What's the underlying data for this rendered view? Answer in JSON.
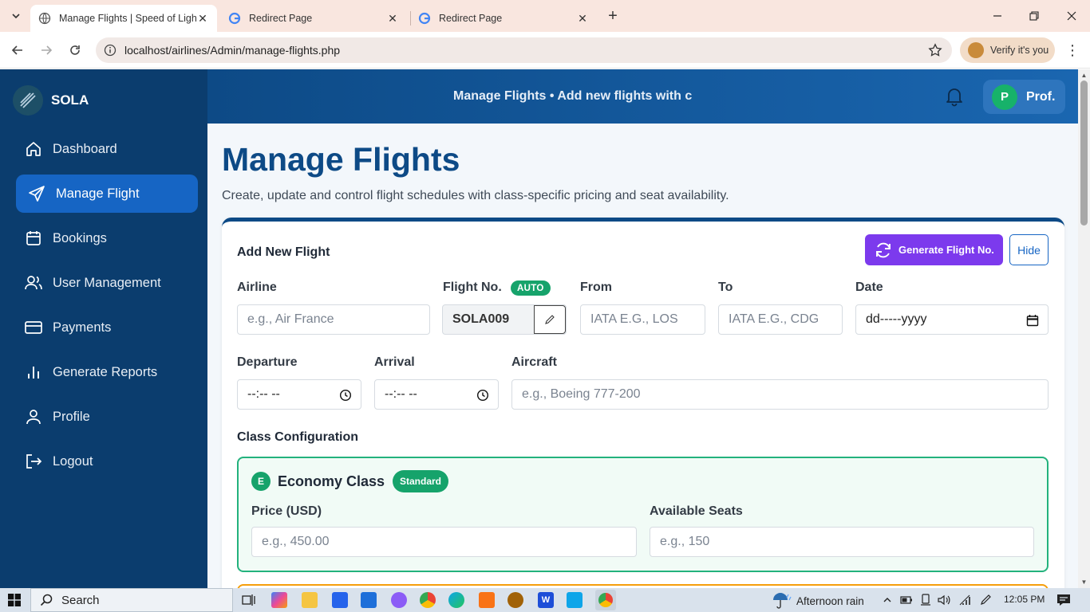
{
  "browser": {
    "tabs": [
      {
        "title": "Manage Flights | Speed of Light",
        "active": true
      },
      {
        "title": "Redirect Page",
        "active": false
      },
      {
        "title": "Redirect Page",
        "active": false
      }
    ],
    "url": "localhost/airlines/Admin/manage-flights.php",
    "verify_label": "Verify it's you"
  },
  "sidebar": {
    "brand": "SOLA",
    "items": [
      {
        "label": "Dashboard",
        "icon": "home-icon"
      },
      {
        "label": "Manage Flight",
        "icon": "plane-icon",
        "active": true
      },
      {
        "label": "Bookings",
        "icon": "calendar-icon"
      },
      {
        "label": "User Management",
        "icon": "users-icon"
      },
      {
        "label": "Payments",
        "icon": "card-icon"
      },
      {
        "label": "Generate Reports",
        "icon": "bar-chart-icon"
      },
      {
        "label": "Profile",
        "icon": "user-icon"
      },
      {
        "label": "Logout",
        "icon": "logout-icon"
      }
    ]
  },
  "header": {
    "title": "Manage Flights • Add new flights with c",
    "avatar_initial": "P",
    "user_name": "Prof."
  },
  "main": {
    "title": "Manage Flights",
    "subtitle": "Create, update and control flight schedules with class-specific pricing and seat availability."
  },
  "form": {
    "card_title": "Add New Flight",
    "generate_label": "Generate Flight No.",
    "hide_label": "Hide",
    "airline": {
      "label": "Airline",
      "placeholder": "e.g., Air France"
    },
    "flight_no": {
      "label": "Flight No.",
      "badge": "AUTO",
      "value": "SOLA009"
    },
    "from": {
      "label": "From",
      "placeholder": "IATA E.G., LOS"
    },
    "to": {
      "label": "To",
      "placeholder": "IATA E.G., CDG"
    },
    "date": {
      "label": "Date",
      "placeholder": "dd-----yyyy"
    },
    "departure": {
      "label": "Departure",
      "placeholder": "--:-- --"
    },
    "arrival": {
      "label": "Arrival",
      "placeholder": "--:-- --"
    },
    "aircraft": {
      "label": "Aircraft",
      "placeholder": "e.g., Boeing 777-200"
    },
    "class_config_label": "Class Configuration",
    "economy": {
      "badge": "E",
      "title": "Economy Class",
      "tag": "Standard",
      "price_label": "Price (USD)",
      "price_placeholder": "e.g., 450.00",
      "seats_label": "Available Seats",
      "seats_placeholder": "e.g., 150"
    }
  },
  "taskbar": {
    "search": "Search",
    "weather": "Afternoon rain",
    "time": "12:05 PM"
  },
  "colors": {
    "sidebar": "#0b3d6e",
    "accent": "#1665c4",
    "generate": "#7c3aed",
    "success": "#16a36b"
  }
}
